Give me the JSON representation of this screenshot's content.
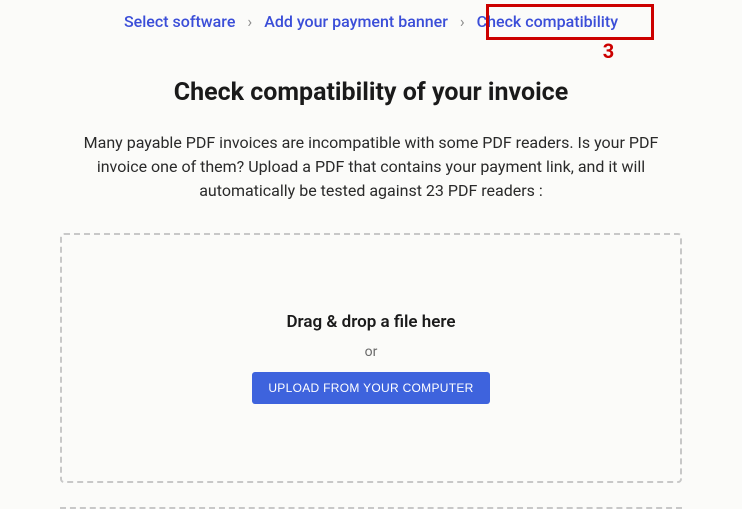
{
  "breadcrumb": {
    "step1": "Select software",
    "step2": "Add your payment banner",
    "step3": "Check compatibility"
  },
  "annotation": {
    "number": "3"
  },
  "page": {
    "title": "Check compatibility of your invoice",
    "description": "Many payable PDF invoices are incompatible with some PDF readers. Is your PDF invoice one of them? Upload a PDF that contains your payment link, and it will automatically be tested against 23 PDF readers :"
  },
  "dropzone": {
    "dragText": "Drag & drop a file here",
    "orText": "or",
    "uploadButton": "UPLOAD FROM YOUR COMPUTER"
  }
}
